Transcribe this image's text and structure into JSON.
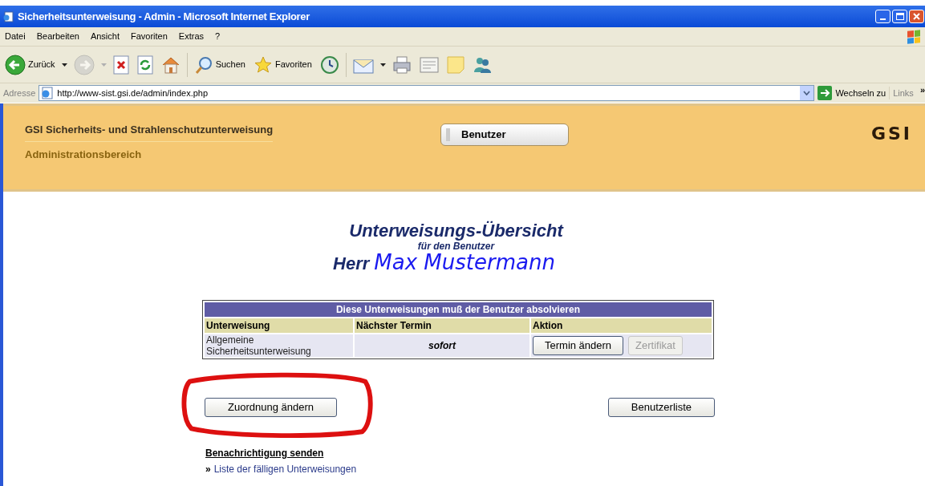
{
  "window": {
    "title": "Sicherheitsunterweisung - Admin - Microsoft Internet Explorer"
  },
  "menu": [
    "Datei",
    "Bearbeiten",
    "Ansicht",
    "Favoriten",
    "Extras",
    "?"
  ],
  "toolbar": [
    {
      "kind": "back",
      "label": "Zurück",
      "dropdown": true,
      "disabled": false
    },
    {
      "kind": "forward",
      "dropdown": true,
      "disabled": true
    },
    {
      "kind": "stop",
      "dropdown": false,
      "disabled": false
    },
    {
      "kind": "refresh",
      "dropdown": false,
      "disabled": false
    },
    {
      "kind": "home",
      "dropdown": false,
      "disabled": false
    },
    {
      "kind": "search",
      "label": "Suchen",
      "dropdown": false,
      "disabled": false
    },
    {
      "kind": "favorites",
      "label": "Favoriten",
      "dropdown": false,
      "disabled": false
    },
    {
      "kind": "history",
      "dropdown": false,
      "disabled": false
    },
    {
      "kind": "mail",
      "dropdown": true,
      "disabled": false
    },
    {
      "kind": "print",
      "dropdown": false,
      "disabled": false
    },
    {
      "kind": "edit",
      "dropdown": false,
      "disabled": false
    },
    {
      "kind": "notes",
      "dropdown": false,
      "disabled": false
    },
    {
      "kind": "messenger",
      "dropdown": false,
      "disabled": false
    }
  ],
  "address_bar": {
    "label": "Adresse",
    "url": "http://www-sist.gsi.de/admin/index.php",
    "go_button": "Wechseln zu",
    "links": "Links",
    "more": "»"
  },
  "header": {
    "title": "GSI Sicherheits- und Strahlenschutzunterweisung",
    "subtitle": "Administrationsbereich",
    "nav_button": "Benutzer",
    "logo": "GSI"
  },
  "overview": {
    "heading": "Unterweisungs-Übersicht",
    "subheading": "für den Benutzer",
    "salutation": "Herr",
    "user_name": "Max Mustermann"
  },
  "table": {
    "caption": "Diese Unterweisungen muß der Benutzer absolvieren",
    "columns": [
      "Unterweisung",
      "Nächster Termin",
      "Aktion"
    ],
    "rows": [
      {
        "training": "Allgemeine Sicherheitsunterweisung",
        "next_date": "sofort",
        "actions": [
          {
            "label": "Termin ändern",
            "disabled": false
          },
          {
            "label": "Zertifikat",
            "disabled": true
          }
        ]
      }
    ]
  },
  "buttons": [
    {
      "label": "Zuordnung ändern"
    },
    {
      "label": "Benutzerliste"
    }
  ],
  "notification": {
    "heading": "Benachrichtigung senden",
    "links": [
      {
        "bullet": "»",
        "label": "Liste der fälligen Unterweisungen"
      }
    ]
  }
}
